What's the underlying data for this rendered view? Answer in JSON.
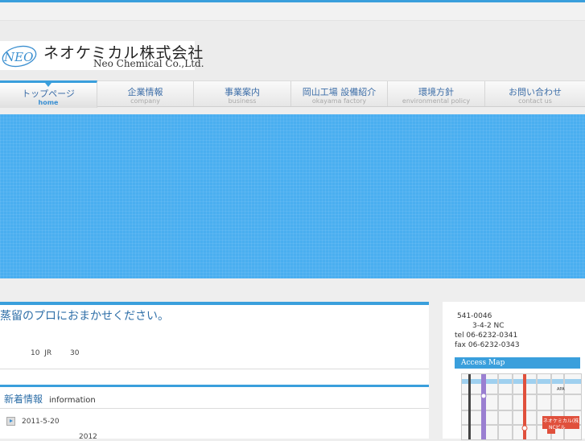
{
  "logo": {
    "mark_text": "NEO",
    "name_jp": "ネオケミカル株式会社",
    "name_en": "Neo Chemical Co.,Ltd."
  },
  "nav": [
    {
      "jp": "トップページ",
      "en": "home",
      "active": true
    },
    {
      "jp": "企業情報",
      "en": "company",
      "active": false
    },
    {
      "jp": "事業案内",
      "en": "business",
      "active": false
    },
    {
      "jp": "岡山工場 設備紹介",
      "en": "okayama factory",
      "active": false
    },
    {
      "jp": "環境方針",
      "en": "environmental policy",
      "active": false
    },
    {
      "jp": "お問い合わせ",
      "en": "contact us",
      "active": false
    }
  ],
  "main": {
    "headline": "蒸留のプロにおまかせください。",
    "sub_a": "10",
    "sub_b": "JR",
    "sub_c": "30"
  },
  "news": {
    "title": "新着情報",
    "title_en": "information",
    "items": [
      {
        "date": "2011-5-20",
        "sub": "2012"
      }
    ]
  },
  "sidebar": {
    "postal": "541-0046",
    "address": "3-4-2 NC",
    "tel": "tel 06-6232-0341",
    "fax": "fax 06-6232-0343",
    "access_title": "Access Map",
    "map": {
      "label_company": "ネオケミカル(株)",
      "label_nc": "NCビル",
      "label_apa": "APA"
    }
  },
  "colors": {
    "accent": "#3a9fdc",
    "hero": "#4aaef0",
    "nav_text": "#3d6ea8"
  }
}
